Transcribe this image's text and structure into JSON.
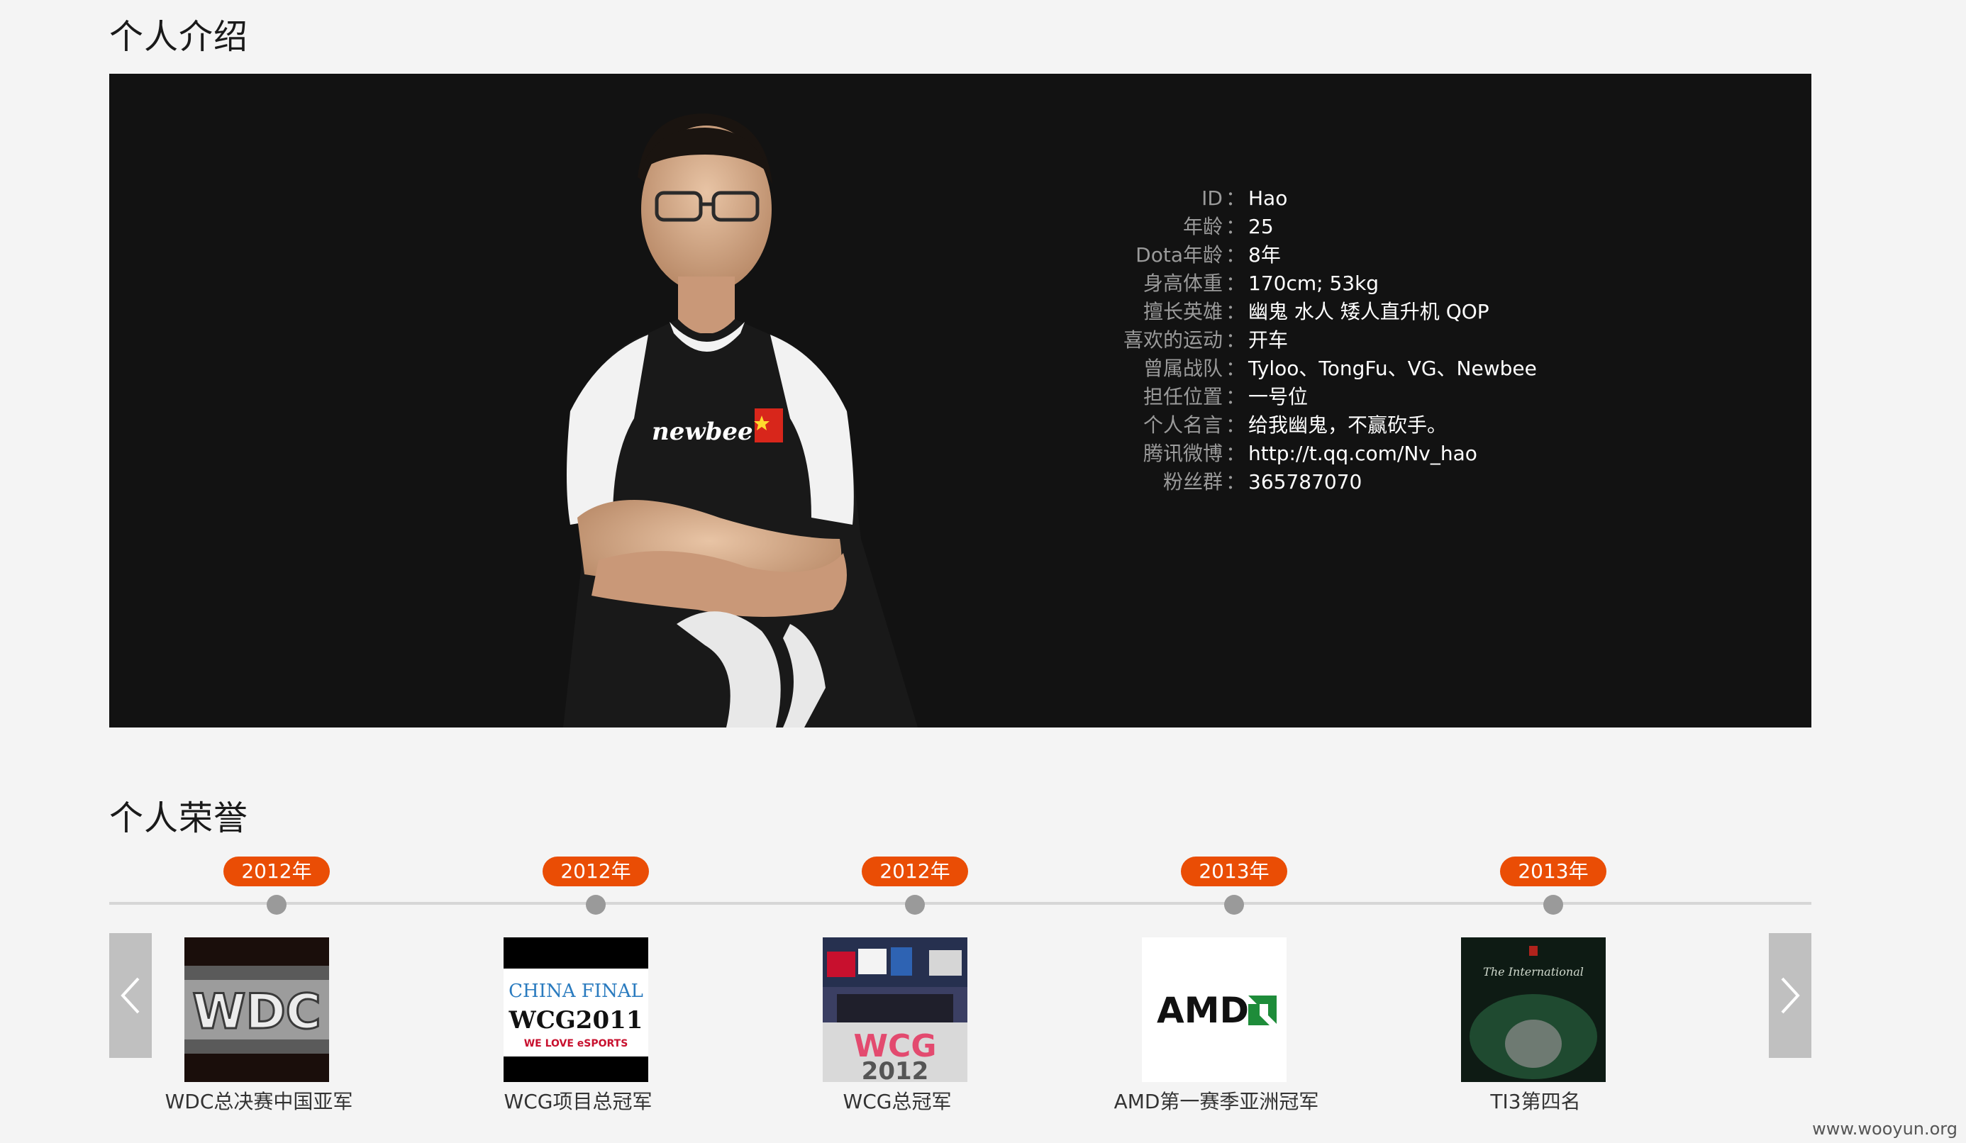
{
  "sections": {
    "intro_title": "个人介绍",
    "honor_title": "个人荣誉"
  },
  "profile": {
    "rows": [
      {
        "label": "ID",
        "value": "Hao"
      },
      {
        "label": "年龄",
        "value": "25"
      },
      {
        "label": "Dota年龄",
        "value": "8年"
      },
      {
        "label": "身高体重",
        "value": "170cm; 53kg"
      },
      {
        "label": "擅长英雄",
        "value": "幽鬼 水人 矮人直升机 QOP"
      },
      {
        "label": "喜欢的运动",
        "value": "开车"
      },
      {
        "label": "曾属战队",
        "value": "Tyloo、TongFu、VG、Newbee"
      },
      {
        "label": "担任位置",
        "value": "一号位"
      },
      {
        "label": "个人名言",
        "value": "给我幽鬼，不赢砍手。"
      },
      {
        "label": "腾讯微博",
        "value": "http://t.qq.com/Nv_hao"
      },
      {
        "label": "粉丝群",
        "value": "365787070"
      }
    ],
    "separator": "：",
    "jersey_text": "newbee"
  },
  "awards": [
    {
      "year": "2012年",
      "caption": "WDC总决赛中国亚军",
      "logo": "WDC"
    },
    {
      "year": "2012年",
      "caption": "WCG项目总冠军",
      "logo_line1": "CHINA FINAL",
      "logo_line2": "WCG2011",
      "logo_line3": "WE LOVE eSPORTS"
    },
    {
      "year": "2012年",
      "caption": "WCG总冠军",
      "logo_line1": "WCG",
      "logo_line2": "2012"
    },
    {
      "year": "2013年",
      "caption": "AMD第一赛季亚洲冠军",
      "logo": "AMD"
    },
    {
      "year": "2013年",
      "caption": "TI3第四名",
      "logo": "The International"
    }
  ],
  "watermark": "www.wooyun.org",
  "colors": {
    "accent": "#ea4d05",
    "banner_bg": "#121212",
    "label_gray": "#9a9a9a"
  },
  "icons": {
    "prev": "chevron-left-icon",
    "next": "chevron-right-icon"
  }
}
